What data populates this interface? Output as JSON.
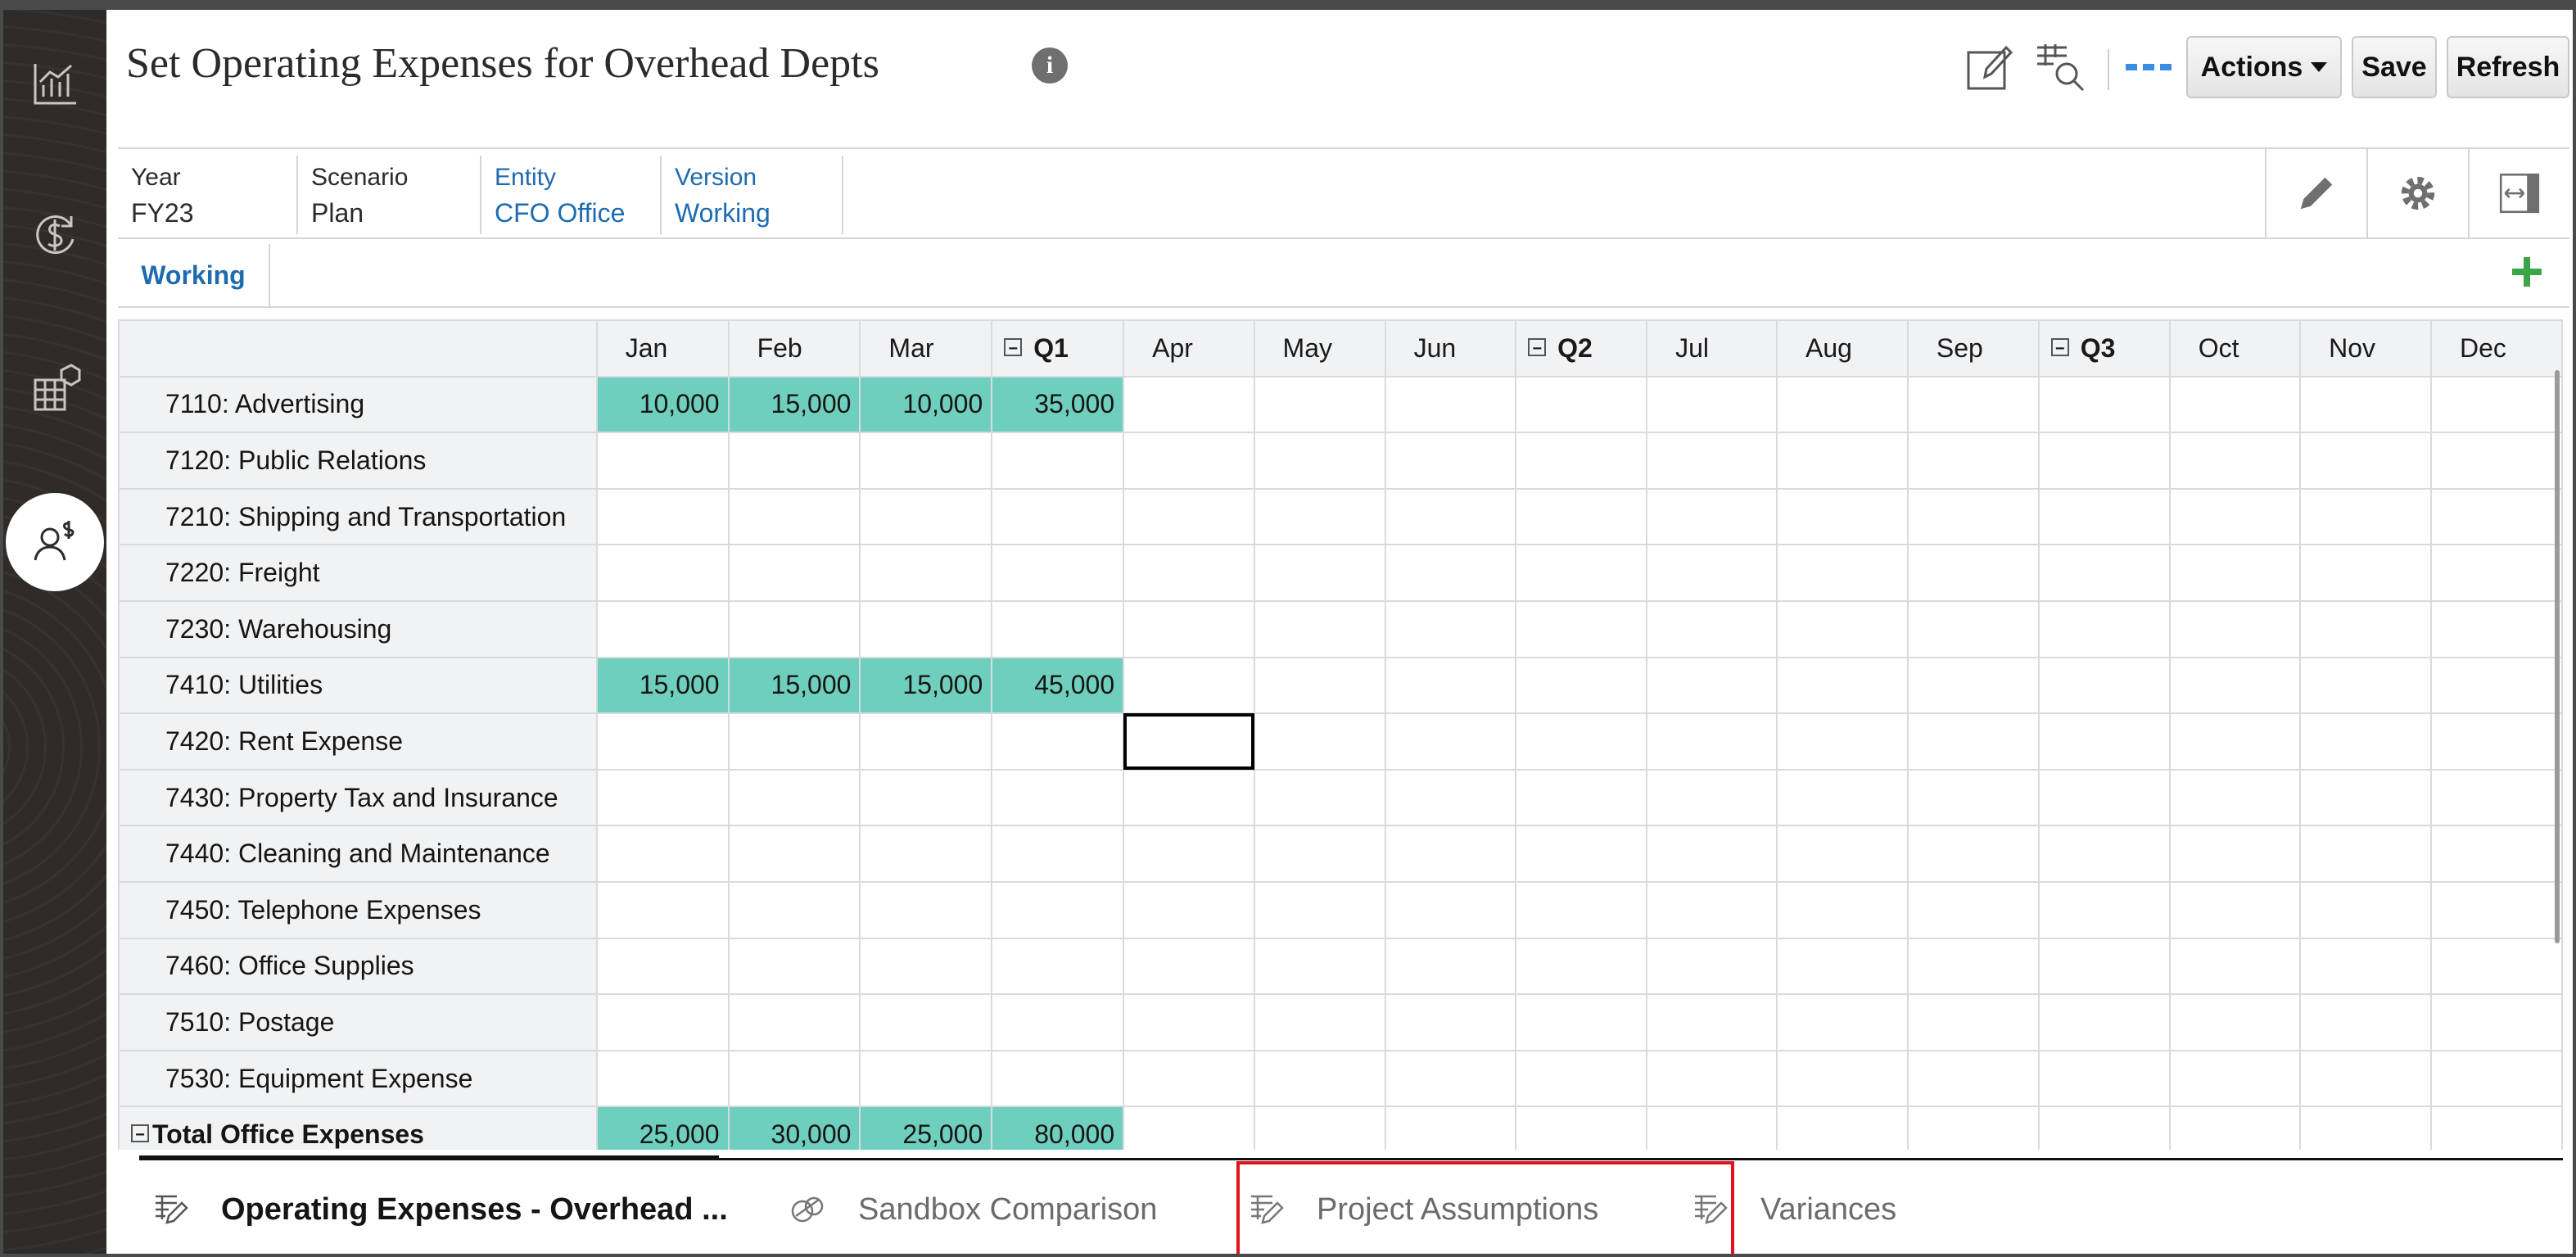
{
  "header": {
    "title": "Set Operating Expenses for Overhead Depts",
    "actions_label": "Actions",
    "save_label": "Save",
    "refresh_label": "Refresh"
  },
  "pov": [
    {
      "label": "Year",
      "value": "FY23"
    },
    {
      "label": "Scenario",
      "value": "Plan"
    },
    {
      "label": "Entity",
      "value": "CFO Office"
    },
    {
      "label": "Version",
      "value": "Working"
    }
  ],
  "version_tab": "Working",
  "grid": {
    "columns": [
      "Jan",
      "Feb",
      "Mar",
      "Q1",
      "Apr",
      "May",
      "Jun",
      "Q2",
      "Jul",
      "Aug",
      "Sep",
      "Q3",
      "Oct",
      "Nov",
      "Dec"
    ],
    "rows": [
      {
        "label": "7110: Advertising",
        "values": [
          "10,000",
          "15,000",
          "10,000",
          "35,000"
        ]
      },
      {
        "label": "7120: Public Relations",
        "values": []
      },
      {
        "label": "7210: Shipping and Transportation",
        "values": []
      },
      {
        "label": "7220: Freight",
        "values": []
      },
      {
        "label": "7230: Warehousing",
        "values": []
      },
      {
        "label": "7410: Utilities",
        "values": [
          "15,000",
          "15,000",
          "15,000",
          "45,000"
        ]
      },
      {
        "label": "7420: Rent Expense",
        "values": []
      },
      {
        "label": "7430: Property Tax and Insurance",
        "values": []
      },
      {
        "label": "7440: Cleaning and Maintenance",
        "values": []
      },
      {
        "label": "7450: Telephone Expenses",
        "values": []
      },
      {
        "label": "7460: Office Supplies",
        "values": []
      },
      {
        "label": "7510: Postage",
        "values": []
      },
      {
        "label": "7530: Equipment Expense",
        "values": []
      },
      {
        "label": "Total Office Expenses",
        "values": [
          "25,000",
          "30,000",
          "25,000",
          "80,000"
        ]
      }
    ]
  },
  "bottom_tabs": [
    {
      "label": "Operating Expenses - Overhead ...",
      "icon": "form-icon"
    },
    {
      "label": "Sandbox Comparison",
      "icon": "sandbox-icon"
    },
    {
      "label": "Project Assumptions",
      "icon": "form-icon"
    },
    {
      "label": "Variances",
      "icon": "form-icon"
    }
  ],
  "colors": {
    "accent": "#1f6bb0",
    "cell_fill": "#6fcfbe",
    "highlight": "#e0121b",
    "rail": "#2f2b28"
  }
}
